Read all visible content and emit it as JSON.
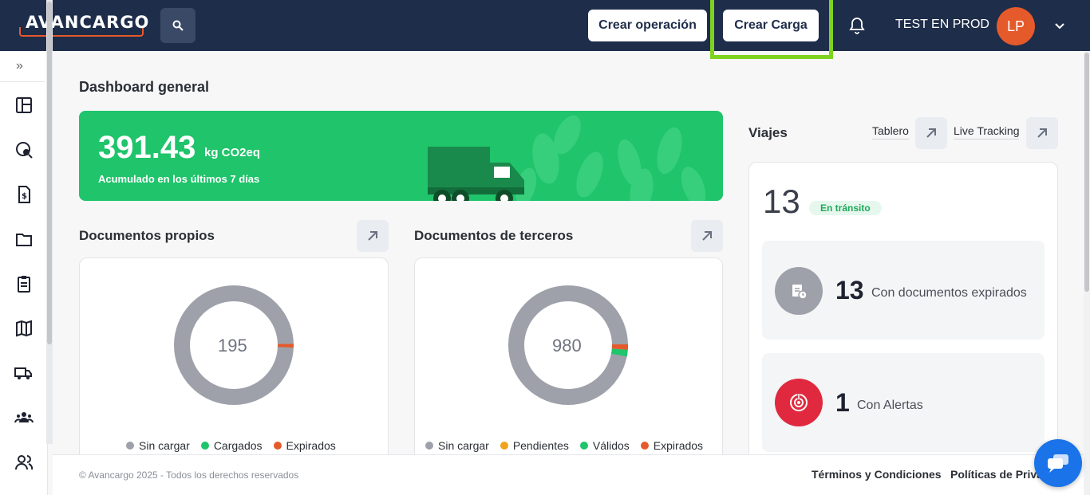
{
  "header": {
    "logo_text": "AVANCARGO",
    "create_operation_label": "Crear operación",
    "create_load_label": "Crear Carga",
    "user_name": "TEST EN PROD",
    "avatar_initials": "LP"
  },
  "sidebar": {
    "expand_glyph": "»",
    "items": [
      {
        "name": "dashboard-icon"
      },
      {
        "name": "tracking-search-icon"
      },
      {
        "name": "invoice-icon"
      },
      {
        "name": "folder-icon"
      },
      {
        "name": "clipboard-icon"
      },
      {
        "name": "map-icon"
      },
      {
        "name": "truck-icon"
      },
      {
        "name": "team-icon"
      },
      {
        "name": "users-icon"
      }
    ]
  },
  "main": {
    "title": "Dashboard general",
    "co2": {
      "value": "391.43",
      "unit": "kg CO2eq",
      "subtitle": "Acumulado en los últimos 7 días"
    },
    "docs_own": {
      "title": "Documentos propios",
      "total": "195",
      "legend": [
        {
          "label": "Sin cargar",
          "color": "#9ea1aa"
        },
        {
          "label": "Cargados",
          "color": "#1fc46b"
        },
        {
          "label": "Expirados",
          "color": "#e55a2b"
        }
      ]
    },
    "docs_third": {
      "title": "Documentos de terceros",
      "total": "980",
      "legend": [
        {
          "label": "Sin cargar",
          "color": "#9ea1aa"
        },
        {
          "label": "Pendientes",
          "color": "#f0a21a"
        },
        {
          "label": "Válidos",
          "color": "#1fc46b"
        },
        {
          "label": "Expirados",
          "color": "#e55a2b"
        }
      ]
    }
  },
  "viajes": {
    "title": "Viajes",
    "tablero_label": "Tablero",
    "live_tracking_label": "Live Tracking",
    "in_transit_count": "13",
    "in_transit_label": "En tránsito",
    "expired_docs_count": "13",
    "expired_docs_label": "Con documentos expirados",
    "alerts_count": "1",
    "alerts_label": "Con Alertas"
  },
  "footer": {
    "copyright": "© Avancargo 2025 - Todos los derechos reservados",
    "terms": "Términos y Condiciones",
    "privacy": "Políticas de Priva"
  },
  "colors": {
    "header_bg": "#1e2d4a",
    "brand_orange": "#e55a2b",
    "co2_green": "#1fc46b",
    "highlight_green": "#7ed321",
    "alert_red": "#e0293e",
    "chat_blue": "#1a73e8"
  }
}
